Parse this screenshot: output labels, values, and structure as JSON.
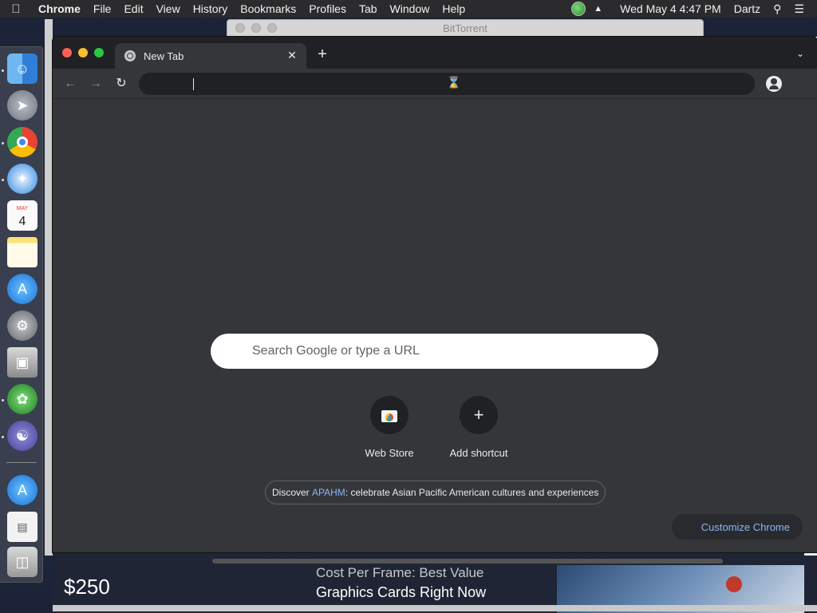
{
  "menubar": {
    "apple_icon": "apple-icon",
    "app_name": "Chrome",
    "menus": [
      "File",
      "Edit",
      "View",
      "History",
      "Bookmarks",
      "Profiles",
      "Tab",
      "Window",
      "Help"
    ],
    "clock": "Wed May 4  4:47 PM",
    "user": "Dartz"
  },
  "background_window": {
    "title": "BitTorrent"
  },
  "background_page": {
    "price": "$250",
    "headline_top": "Cost Per Frame: Best Value",
    "headline_bottom": "Graphics Cards Right Now"
  },
  "dock": {
    "calendar_month": "MAY",
    "calendar_day": "4"
  },
  "chrome": {
    "tab_title": "New Tab",
    "omnibox_value": "",
    "ntp": {
      "search_placeholder": "Search Google or type a URL",
      "shortcuts": [
        {
          "label": "Web Store"
        },
        {
          "label": "Add shortcut"
        }
      ],
      "promo_prefix": "Discover ",
      "promo_link": "APAHM",
      "promo_suffix": ": celebrate Asian Pacific American cultures and experiences",
      "customize_label": "Customize Chrome"
    }
  },
  "colors": {
    "chrome_bg": "#35363a",
    "tabstrip_bg": "#202124",
    "link_blue": "#8ab4f8",
    "close_red": "#ff5f57",
    "minimize_yellow": "#febc2e",
    "zoom_green": "#28c840"
  }
}
